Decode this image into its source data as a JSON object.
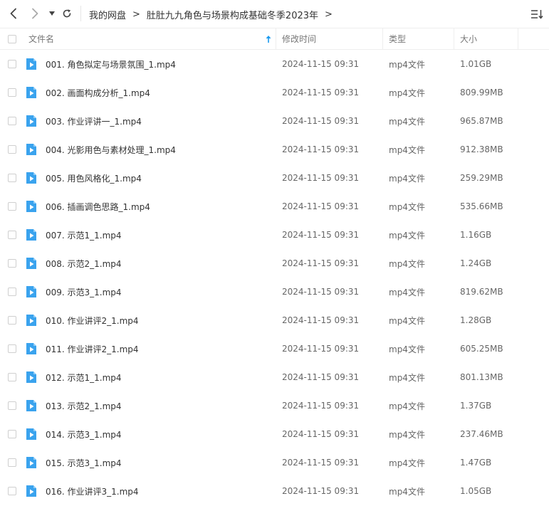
{
  "toolbar": {
    "back_icon": "chevron-left-icon",
    "forward_icon": "chevron-right-icon",
    "dropdown_icon": "caret-down-icon",
    "refresh_icon": "refresh-icon",
    "sort_icon": "sort-list-icon"
  },
  "breadcrumb": {
    "root": "我的网盘",
    "current": "肚肚九九角色与场景构成基础冬季2023年",
    "separator": ">"
  },
  "columns": {
    "name": "文件名",
    "modified": "修改时间",
    "type": "类型",
    "size": "大小",
    "sort_indicator_color": "#1b9aee"
  },
  "colors": {
    "file_icon": "#3aa3ee",
    "text_primary": "#333333",
    "text_secondary": "#666666"
  },
  "files": [
    {
      "name": "001.  角色拟定与场景氛围_1.mp4",
      "modified": "2024-11-15 09:31",
      "type": "mp4文件",
      "size": "1.01GB"
    },
    {
      "name": "002.  画面构成分析_1.mp4",
      "modified": "2024-11-15 09:31",
      "type": "mp4文件",
      "size": "809.99MB"
    },
    {
      "name": "003.  作业评讲一_1.mp4",
      "modified": "2024-11-15 09:31",
      "type": "mp4文件",
      "size": "965.87MB"
    },
    {
      "name": "004.  光影用色与素材处理_1.mp4",
      "modified": "2024-11-15 09:31",
      "type": "mp4文件",
      "size": "912.38MB"
    },
    {
      "name": "005.  用色风格化_1.mp4",
      "modified": "2024-11-15 09:31",
      "type": "mp4文件",
      "size": "259.29MB"
    },
    {
      "name": "006.  插画调色思路_1.mp4",
      "modified": "2024-11-15 09:31",
      "type": "mp4文件",
      "size": "535.66MB"
    },
    {
      "name": "007.  示范1_1.mp4",
      "modified": "2024-11-15 09:31",
      "type": "mp4文件",
      "size": "1.16GB"
    },
    {
      "name": "008.  示范2_1.mp4",
      "modified": "2024-11-15 09:31",
      "type": "mp4文件",
      "size": "1.24GB"
    },
    {
      "name": "009.  示范3_1.mp4",
      "modified": "2024-11-15 09:31",
      "type": "mp4文件",
      "size": "819.62MB"
    },
    {
      "name": "010.  作业讲评2_1.mp4",
      "modified": "2024-11-15 09:31",
      "type": "mp4文件",
      "size": "1.28GB"
    },
    {
      "name": "011.  作业讲评2_1.mp4",
      "modified": "2024-11-15 09:31",
      "type": "mp4文件",
      "size": "605.25MB"
    },
    {
      "name": "012.  示范1_1.mp4",
      "modified": "2024-11-15 09:31",
      "type": "mp4文件",
      "size": "801.13MB"
    },
    {
      "name": "013.  示范2_1.mp4",
      "modified": "2024-11-15 09:31",
      "type": "mp4文件",
      "size": "1.37GB"
    },
    {
      "name": "014.  示范3_1.mp4",
      "modified": "2024-11-15 09:31",
      "type": "mp4文件",
      "size": "237.46MB"
    },
    {
      "name": "015.  示范3_1.mp4",
      "modified": "2024-11-15 09:31",
      "type": "mp4文件",
      "size": "1.47GB"
    },
    {
      "name": "016.  作业讲评3_1.mp4",
      "modified": "2024-11-15 09:31",
      "type": "mp4文件",
      "size": "1.05GB"
    }
  ]
}
